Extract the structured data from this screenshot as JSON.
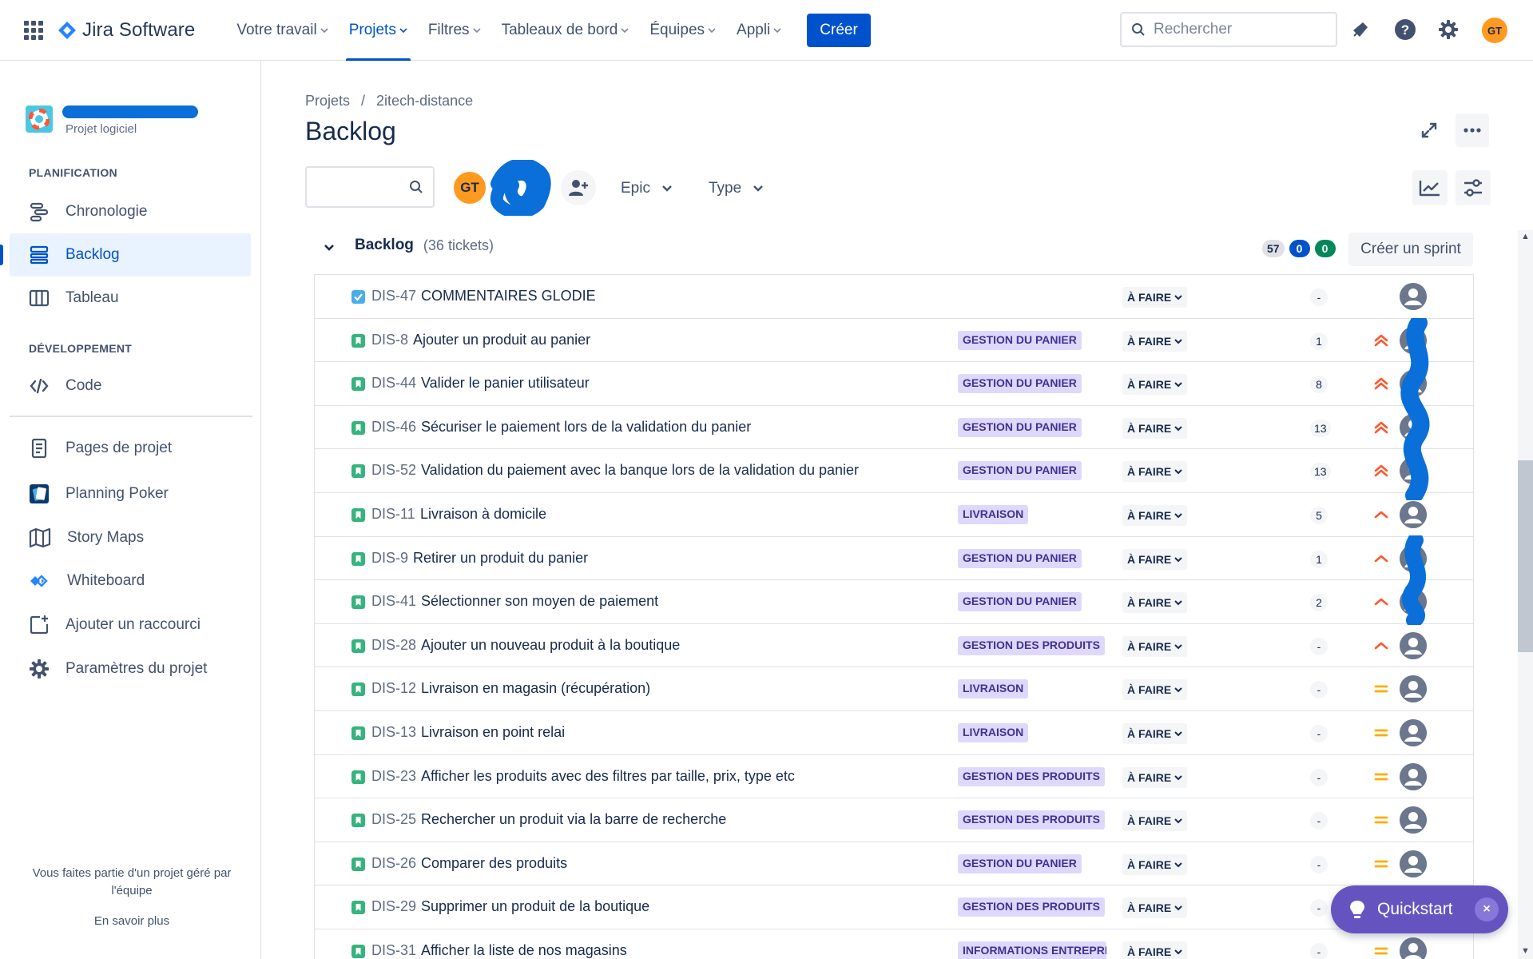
{
  "app": {
    "name": "Jira Software",
    "nav": [
      "Votre travail",
      "Projets",
      "Filtres",
      "Tableaux de bord",
      "Équipes",
      "Appli"
    ],
    "create_label": "Créer",
    "search_placeholder": "Rechercher",
    "user_initials": "GT"
  },
  "sidebar": {
    "project_type": "Projet logiciel",
    "section_planning": "PLANIFICATION",
    "section_dev": "DÉVELOPPEMENT",
    "items": [
      {
        "label": "Chronologie",
        "icon": "timeline-icon"
      },
      {
        "label": "Backlog",
        "icon": "backlog-icon",
        "active": true
      },
      {
        "label": "Tableau",
        "icon": "board-icon"
      },
      {
        "label": "Code",
        "icon": "code-icon"
      },
      {
        "label": "Pages de projet",
        "icon": "page-icon"
      },
      {
        "label": "Planning Poker",
        "icon": "planning-poker-icon"
      },
      {
        "label": "Story Maps",
        "icon": "map-icon"
      },
      {
        "label": "Whiteboard",
        "icon": "whiteboard-icon"
      },
      {
        "label": "Ajouter un raccourci",
        "icon": "add-shortcut-icon"
      },
      {
        "label": "Paramètres du projet",
        "icon": "settings-icon"
      }
    ],
    "footer_text": "Vous faites partie d'un projet géré par l'équipe",
    "footer_link": "En savoir plus"
  },
  "main": {
    "breadcrumb": [
      "Projets",
      "/",
      "2itech-distance"
    ],
    "title": "Backlog",
    "filters": {
      "assignee_initials": "GT",
      "epic_label": "Epic",
      "type_label": "Type"
    },
    "backlog": {
      "title": "Backlog",
      "count_label": "(36 tickets)",
      "badge_total": "57",
      "badge_in_progress": "0",
      "badge_done": "0",
      "create_sprint_label": "Créer un sprint"
    },
    "issues": [
      {
        "key": "DIS-47",
        "summary": "COMMENTAIRES GLODIE",
        "epic": "",
        "status": "À FAIRE",
        "points": "-",
        "priority": "none",
        "type": "task"
      },
      {
        "key": "DIS-8",
        "summary": "Ajouter un produit au panier",
        "epic": "GESTION DU PANIER",
        "status": "À FAIRE",
        "points": "1",
        "priority": "highest",
        "type": "story"
      },
      {
        "key": "DIS-44",
        "summary": "Valider le panier utilisateur",
        "epic": "GESTION DU PANIER",
        "status": "À FAIRE",
        "points": "8",
        "priority": "highest",
        "type": "story"
      },
      {
        "key": "DIS-46",
        "summary": "Sécuriser le paiement lors de la validation du panier",
        "epic": "GESTION DU PANIER",
        "status": "À FAIRE",
        "points": "13",
        "priority": "highest",
        "type": "story"
      },
      {
        "key": "DIS-52",
        "summary": "Validation du paiement avec la banque lors de la validation du panier",
        "epic": "GESTION DU PANIER",
        "status": "À FAIRE",
        "points": "13",
        "priority": "highest",
        "type": "story"
      },
      {
        "key": "DIS-11",
        "summary": "Livraison à domicile",
        "epic": "LIVRAISON",
        "status": "À FAIRE",
        "points": "5",
        "priority": "high",
        "type": "story"
      },
      {
        "key": "DIS-9",
        "summary": "Retirer un produit du panier",
        "epic": "GESTION DU PANIER",
        "status": "À FAIRE",
        "points": "1",
        "priority": "high",
        "type": "story"
      },
      {
        "key": "DIS-41",
        "summary": "Sélectionner son moyen de paiement",
        "epic": "GESTION DU PANIER",
        "status": "À FAIRE",
        "points": "2",
        "priority": "high",
        "type": "story"
      },
      {
        "key": "DIS-28",
        "summary": "Ajouter un nouveau produit à la boutique",
        "epic": "GESTION DES PRODUITS",
        "status": "À FAIRE",
        "points": "-",
        "priority": "high",
        "type": "story"
      },
      {
        "key": "DIS-12",
        "summary": "Livraison en magasin (récupération)",
        "epic": "LIVRAISON",
        "status": "À FAIRE",
        "points": "-",
        "priority": "medium",
        "type": "story"
      },
      {
        "key": "DIS-13",
        "summary": "Livraison en point relai",
        "epic": "LIVRAISON",
        "status": "À FAIRE",
        "points": "-",
        "priority": "medium",
        "type": "story"
      },
      {
        "key": "DIS-23",
        "summary": "Afficher les produits avec des filtres par taille, prix, type etc",
        "epic": "GESTION DES PRODUITS",
        "status": "À FAIRE",
        "points": "-",
        "priority": "medium",
        "type": "story"
      },
      {
        "key": "DIS-25",
        "summary": "Rechercher un produit via la barre de recherche",
        "epic": "GESTION DES PRODUITS",
        "status": "À FAIRE",
        "points": "-",
        "priority": "medium",
        "type": "story"
      },
      {
        "key": "DIS-26",
        "summary": "Comparer des produits",
        "epic": "GESTION DU PANIER",
        "status": "À FAIRE",
        "points": "-",
        "priority": "medium",
        "type": "story"
      },
      {
        "key": "DIS-29",
        "summary": "Supprimer un produit de la boutique",
        "epic": "GESTION DES PRODUITS",
        "status": "À FAIRE",
        "points": "-",
        "priority": "medium",
        "type": "story"
      },
      {
        "key": "DIS-31",
        "summary": "Afficher la liste de nos magasins",
        "epic": "INFORMATIONS ENTREPRI",
        "status": "À FAIRE",
        "points": "-",
        "priority": "medium",
        "type": "story"
      }
    ]
  },
  "quickstart": {
    "label": "Quickstart",
    "close": "×"
  },
  "colors": {
    "primary": "#0052cc",
    "story_green": "#36b37e",
    "task_blue": "#4bade8",
    "epic_bg": "#dfd8fd",
    "epic_text": "#403294",
    "priority_high": "#ff5630",
    "priority_medium": "#ffab00",
    "quickstart": "#6554c0"
  }
}
